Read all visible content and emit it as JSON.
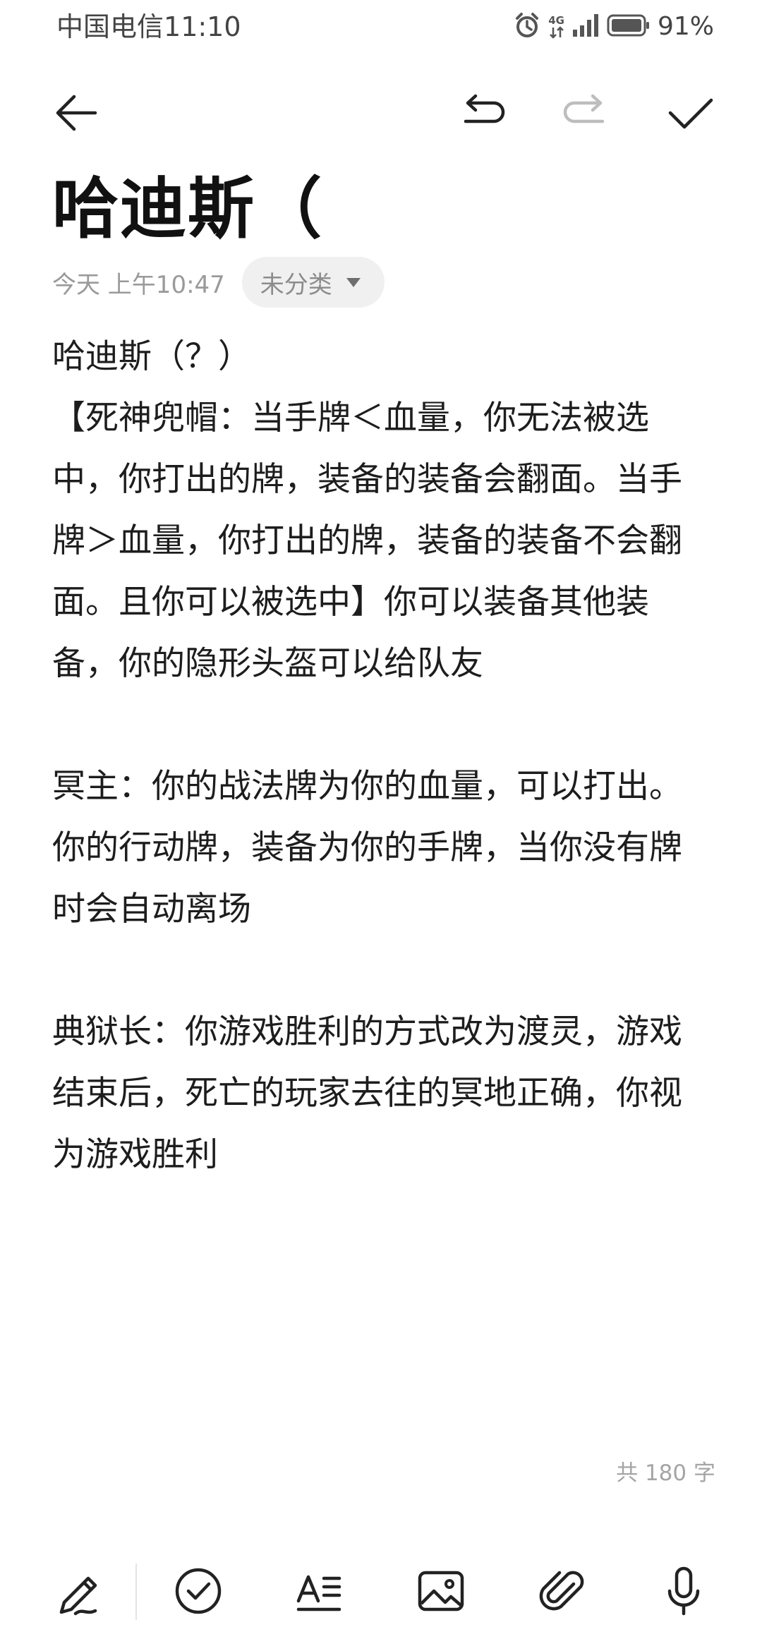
{
  "status_bar": {
    "carrier": "中国电信",
    "time": "11:10",
    "network": "4G",
    "battery_percent": "91%"
  },
  "toolbar": {
    "back_icon": "arrow-left-icon",
    "undo_icon": "undo-icon",
    "redo_icon": "redo-icon",
    "done_icon": "check-icon"
  },
  "note": {
    "title": "哈迪斯（",
    "date": "今天 上午10:47",
    "category": "未分类",
    "paragraphs": [
      "哈迪斯（？）\n【死神兜帽：当手牌＜血量，你无法被选中，你打出的牌，装备的装备会翻面。当手牌＞血量，你打出的牌，装备的装备不会翻面。且你可以被选中】你可以装备其他装备，你的隐形头盔可以给队友",
      "冥主：你的战法牌为你的血量，可以打出。你的行动牌，装备为你的手牌，当你没有牌时会自动离场",
      "典狱长：你游戏胜利的方式改为渡灵，游戏结束后，死亡的玩家去往的冥地正确，你视为游戏胜利"
    ],
    "word_count": "共 180 字"
  },
  "bottom_toolbar": {
    "items": [
      "handwriting-pen-icon",
      "checklist-icon",
      "text-format-icon",
      "image-icon",
      "attachment-icon",
      "microphone-icon"
    ]
  },
  "colors": {
    "text": "#1d1d1d",
    "muted": "#9a9a9a",
    "chip_bg": "#f0f0f0",
    "icon": "#222222",
    "icon_disabled": "#bdbdbd"
  }
}
